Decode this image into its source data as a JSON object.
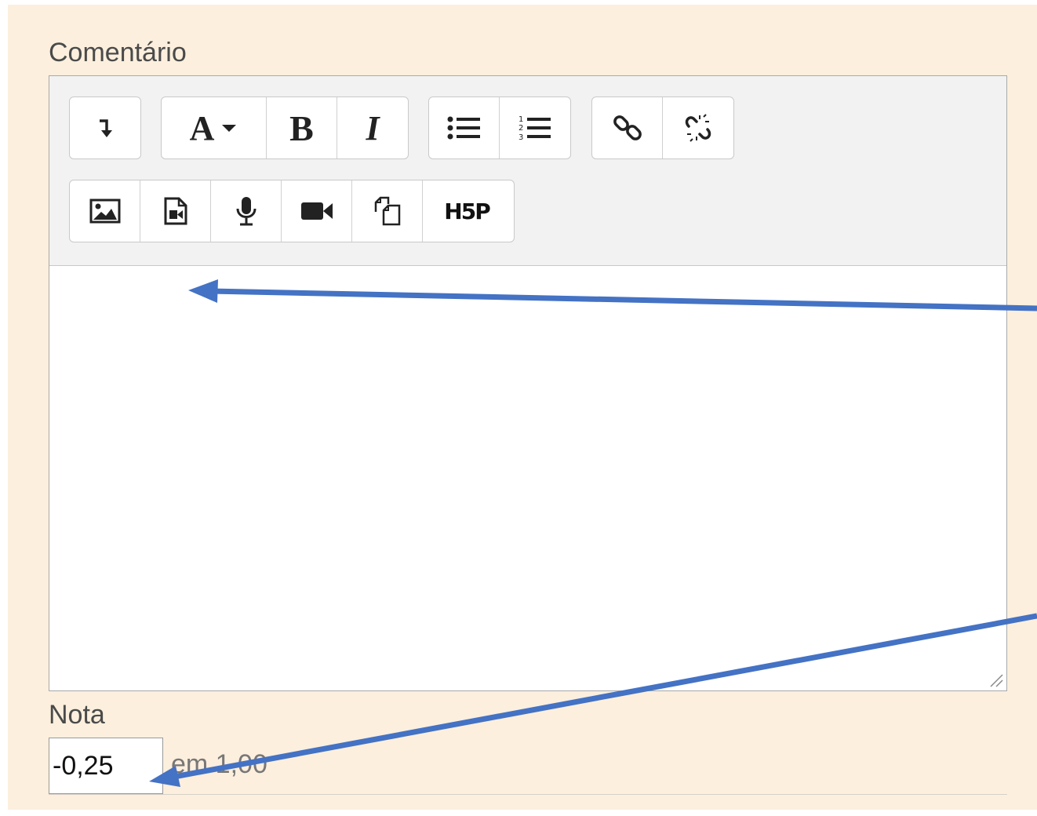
{
  "comment_label": "Comentário",
  "toolbar": {
    "row1": [
      {
        "name": "expand-toolbar-button",
        "icon": "arrow-down-icon",
        "glyph": "↧"
      },
      {
        "name": "font-style-button",
        "icon": "font-icon",
        "glyph": "A▾"
      },
      {
        "name": "bold-button",
        "icon": "bold-icon",
        "glyph": "B"
      },
      {
        "name": "italic-button",
        "icon": "italic-icon",
        "glyph": "I"
      },
      {
        "name": "unordered-list-button",
        "icon": "bullet-list-icon"
      },
      {
        "name": "ordered-list-button",
        "icon": "numbered-list-icon"
      },
      {
        "name": "link-button",
        "icon": "link-icon"
      },
      {
        "name": "unlink-button",
        "icon": "unlink-icon"
      }
    ],
    "row2": [
      {
        "name": "insert-image-button",
        "icon": "image-icon"
      },
      {
        "name": "insert-media-button",
        "icon": "media-file-icon"
      },
      {
        "name": "record-audio-button",
        "icon": "microphone-icon"
      },
      {
        "name": "record-video-button",
        "icon": "video-camera-icon"
      },
      {
        "name": "manage-files-button",
        "icon": "copy-files-icon"
      },
      {
        "name": "insert-h5p-button",
        "icon": "h5p-icon",
        "glyph": "H5P"
      }
    ]
  },
  "grade": {
    "label": "Nota",
    "value": "-0,25",
    "suffix": "em 1,00"
  },
  "colors": {
    "panel_background": "#fcefdd",
    "annotation_arrow": "#4472c4"
  }
}
